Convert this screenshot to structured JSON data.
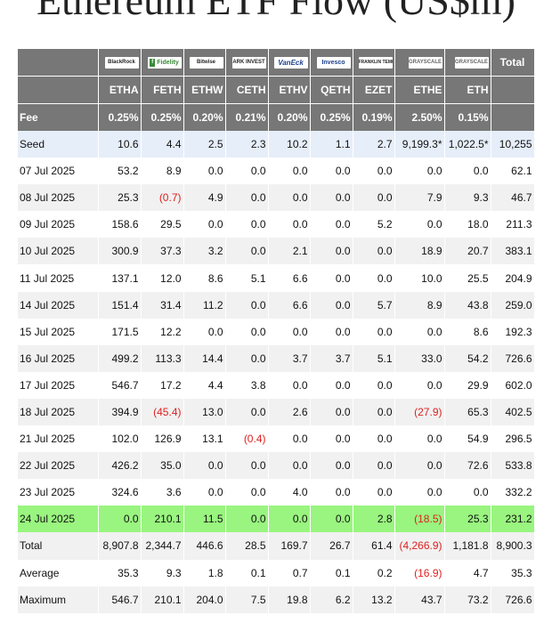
{
  "page": {
    "title": "Ethereum ETF Flow (US$m)"
  },
  "colors": {
    "header_bg": "#777777",
    "seed_row_bg": "#e6eef9",
    "alt_row_bg": "#f1f1f1",
    "highlight_row_bg": "#99f57f",
    "negative_text": "#e02020"
  },
  "table": {
    "logos": [
      {
        "name": "blackrock-logo",
        "text": "BlackRock"
      },
      {
        "name": "fidelity-logo",
        "text": "Fidelity"
      },
      {
        "name": "bitwise-logo",
        "text": "Bitwise"
      },
      {
        "name": "ark-logo",
        "text": "ARK INVEST"
      },
      {
        "name": "vaneck-logo",
        "text": "VanEck"
      },
      {
        "name": "invesco-logo",
        "text": "Invesco"
      },
      {
        "name": "franklin-templeton-logo",
        "text": "FRANKLIN TEMPLETON"
      },
      {
        "name": "grayscale-logo",
        "text": "GRAYSCALE"
      },
      {
        "name": "grayscale-logo",
        "text": "GRAYSCALE"
      }
    ],
    "total_label": "Total",
    "tickers": [
      "ETHA",
      "FETH",
      "ETHW",
      "CETH",
      "ETHV",
      "QETH",
      "EZET",
      "ETHE",
      "ETH"
    ],
    "fee_label": "Fee",
    "fees": [
      "0.25%",
      "0.25%",
      "0.20%",
      "0.21%",
      "0.20%",
      "0.25%",
      "0.19%",
      "2.50%",
      "0.15%"
    ],
    "rows": [
      {
        "label": "Seed",
        "style": "seed",
        "values": [
          "10.6",
          "4.4",
          "2.5",
          "2.3",
          "10.2",
          "1.1",
          "2.7",
          "9,199.3*",
          "1,022.5*"
        ],
        "total": "10,255"
      },
      {
        "label": "07 Jul 2025",
        "style": "plain",
        "values": [
          "53.2",
          "8.9",
          "0.0",
          "0.0",
          "0.0",
          "0.0",
          "0.0",
          "0.0",
          "0.0"
        ],
        "total": "62.1"
      },
      {
        "label": "08 Jul 2025",
        "style": "alt",
        "values": [
          "25.3",
          "(0.7)",
          "4.9",
          "0.0",
          "0.0",
          "0.0",
          "0.0",
          "7.9",
          "9.3"
        ],
        "total": "46.7"
      },
      {
        "label": "09 Jul 2025",
        "style": "plain",
        "values": [
          "158.6",
          "29.5",
          "0.0",
          "0.0",
          "0.0",
          "0.0",
          "5.2",
          "0.0",
          "18.0"
        ],
        "total": "211.3"
      },
      {
        "label": "10 Jul 2025",
        "style": "alt",
        "values": [
          "300.9",
          "37.3",
          "3.2",
          "0.0",
          "2.1",
          "0.0",
          "0.0",
          "18.9",
          "20.7"
        ],
        "total": "383.1"
      },
      {
        "label": "11 Jul 2025",
        "style": "plain",
        "values": [
          "137.1",
          "12.0",
          "8.6",
          "5.1",
          "6.6",
          "0.0",
          "0.0",
          "10.0",
          "25.5"
        ],
        "total": "204.9"
      },
      {
        "label": "14 Jul 2025",
        "style": "alt",
        "values": [
          "151.4",
          "31.4",
          "11.2",
          "0.0",
          "6.6",
          "0.0",
          "5.7",
          "8.9",
          "43.8"
        ],
        "total": "259.0"
      },
      {
        "label": "15 Jul 2025",
        "style": "plain",
        "values": [
          "171.5",
          "12.2",
          "0.0",
          "0.0",
          "0.0",
          "0.0",
          "0.0",
          "0.0",
          "8.6"
        ],
        "total": "192.3"
      },
      {
        "label": "16 Jul 2025",
        "style": "alt",
        "values": [
          "499.2",
          "113.3",
          "14.4",
          "0.0",
          "3.7",
          "3.7",
          "5.1",
          "33.0",
          "54.2"
        ],
        "total": "726.6"
      },
      {
        "label": "17 Jul 2025",
        "style": "plain",
        "values": [
          "546.7",
          "17.2",
          "4.4",
          "3.8",
          "0.0",
          "0.0",
          "0.0",
          "0.0",
          "29.9"
        ],
        "total": "602.0"
      },
      {
        "label": "18 Jul 2025",
        "style": "alt",
        "values": [
          "394.9",
          "(45.4)",
          "13.0",
          "0.0",
          "2.6",
          "0.0",
          "0.0",
          "(27.9)",
          "65.3"
        ],
        "total": "402.5"
      },
      {
        "label": "21 Jul 2025",
        "style": "plain",
        "values": [
          "102.0",
          "126.9",
          "13.1",
          "(0.4)",
          "0.0",
          "0.0",
          "0.0",
          "0.0",
          "54.9"
        ],
        "total": "296.5"
      },
      {
        "label": "22 Jul 2025",
        "style": "alt",
        "values": [
          "426.2",
          "35.0",
          "0.0",
          "0.0",
          "0.0",
          "0.0",
          "0.0",
          "0.0",
          "72.6"
        ],
        "total": "533.8"
      },
      {
        "label": "23 Jul 2025",
        "style": "plain",
        "values": [
          "324.6",
          "3.6",
          "0.0",
          "0.0",
          "4.0",
          "0.0",
          "0.0",
          "0.0",
          "0.0"
        ],
        "total": "332.2"
      },
      {
        "label": "24 Jul 2025",
        "style": "highlight",
        "values": [
          "0.0",
          "210.1",
          "11.5",
          "0.0",
          "0.0",
          "0.0",
          "2.8",
          "(18.5)",
          "25.3"
        ],
        "total": "231.2"
      },
      {
        "label": "Total",
        "style": "alt",
        "values": [
          "8,907.8",
          "2,344.7",
          "446.6",
          "28.5",
          "169.7",
          "26.7",
          "61.4",
          "(4,266.9)",
          "1,181.8"
        ],
        "total": "8,900.3"
      },
      {
        "label": "Average",
        "style": "plain",
        "values": [
          "35.3",
          "9.3",
          "1.8",
          "0.1",
          "0.7",
          "0.1",
          "0.2",
          "(16.9)",
          "4.7"
        ],
        "total": "35.3"
      },
      {
        "label": "Maximum",
        "style": "alt",
        "values": [
          "546.7",
          "210.1",
          "204.0",
          "7.5",
          "19.8",
          "6.2",
          "13.2",
          "43.7",
          "73.2"
        ],
        "total": "726.6"
      }
    ]
  }
}
